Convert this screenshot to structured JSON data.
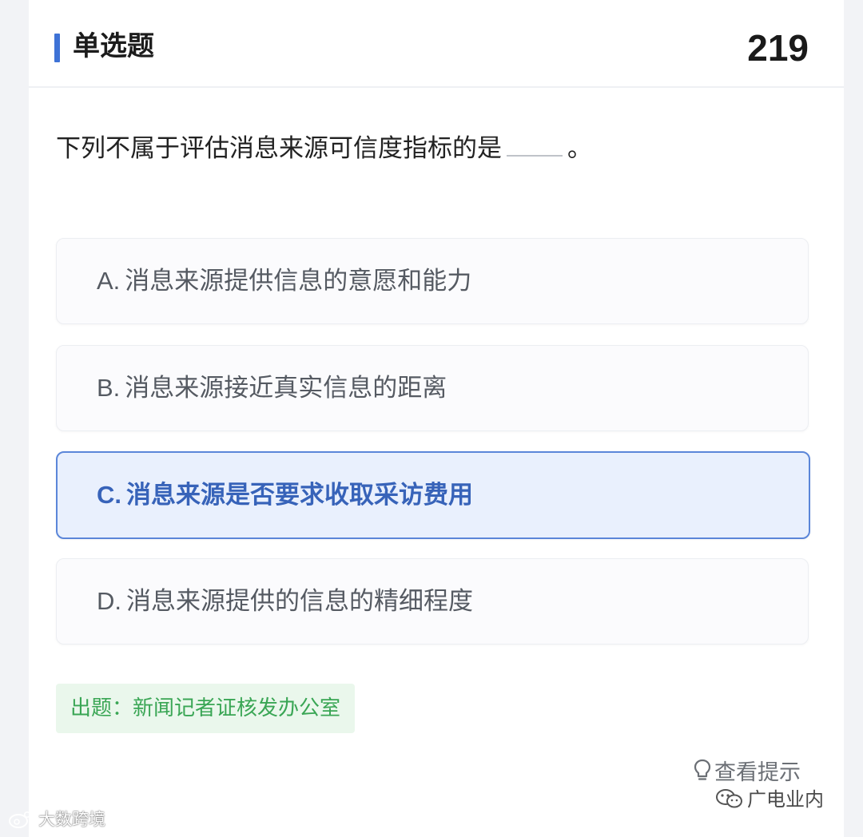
{
  "header": {
    "title": "单选题",
    "count": "219"
  },
  "question": {
    "text_before": "下列不属于评估消息来源可信度指标的是",
    "text_after": "。"
  },
  "options": [
    {
      "letter": "A.",
      "text": "消息来源提供信息的意愿和能力",
      "selected": false
    },
    {
      "letter": "B.",
      "text": "消息来源接近真实信息的距离",
      "selected": false
    },
    {
      "letter": "C.",
      "text": "消息来源是否要求收取采访费用",
      "selected": true
    },
    {
      "letter": "D.",
      "text": "消息来源提供的信息的精细程度",
      "selected": false
    }
  ],
  "source_tag": "出题：新闻记者证核发办公室",
  "hint": {
    "icon": "lightbulb-icon",
    "label": "查看提示"
  },
  "watermarks": {
    "right": "广电业内",
    "left": "大数跨境"
  },
  "colors": {
    "accent": "#3e72d6",
    "selected_bg": "#e9f0fd",
    "selected_text": "#3763b9",
    "source_bg": "#eaf7ec",
    "source_text": "#3aa655"
  }
}
